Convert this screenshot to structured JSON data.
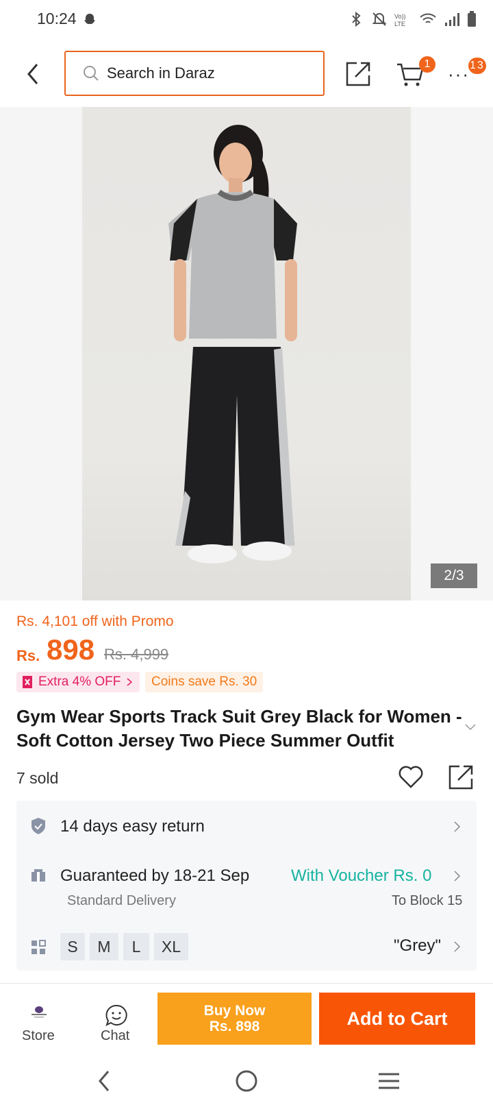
{
  "status_bar": {
    "time": "10:24"
  },
  "header": {
    "search_placeholder": "Search in Daraz",
    "cart_count": "1",
    "more_count": "13"
  },
  "gallery": {
    "counter": "2/3"
  },
  "pricing": {
    "promo": "Rs. 4,101 off with Promo",
    "currency": "Rs.",
    "price": "898",
    "original_price": "Rs. 4,999",
    "extra_off": "Extra 4% OFF",
    "coins": "Coins save Rs. 30"
  },
  "product": {
    "title": "Gym Wear Sports Track Suit Grey Black for Women - Soft Cotton Jersey Two Piece Summer Outfit",
    "sold": "7 sold"
  },
  "info": {
    "return": "14 days easy return",
    "delivery": "Guaranteed by 18-21 Sep",
    "voucher": "With Voucher Rs. 0",
    "delivery_type": "Standard Delivery",
    "location": "To Block 15",
    "sizes": [
      "S",
      "M",
      "L",
      "XL"
    ],
    "color": "\"Grey\""
  },
  "bottom": {
    "store": "Store",
    "chat": "Chat",
    "buy_now_1": "Buy Now",
    "buy_now_2": "Rs. 898",
    "add_to_cart": "Add to Cart"
  },
  "colors": {
    "accent": "#f85606",
    "buy": "#f9a01c",
    "teal": "#16b3a0"
  }
}
